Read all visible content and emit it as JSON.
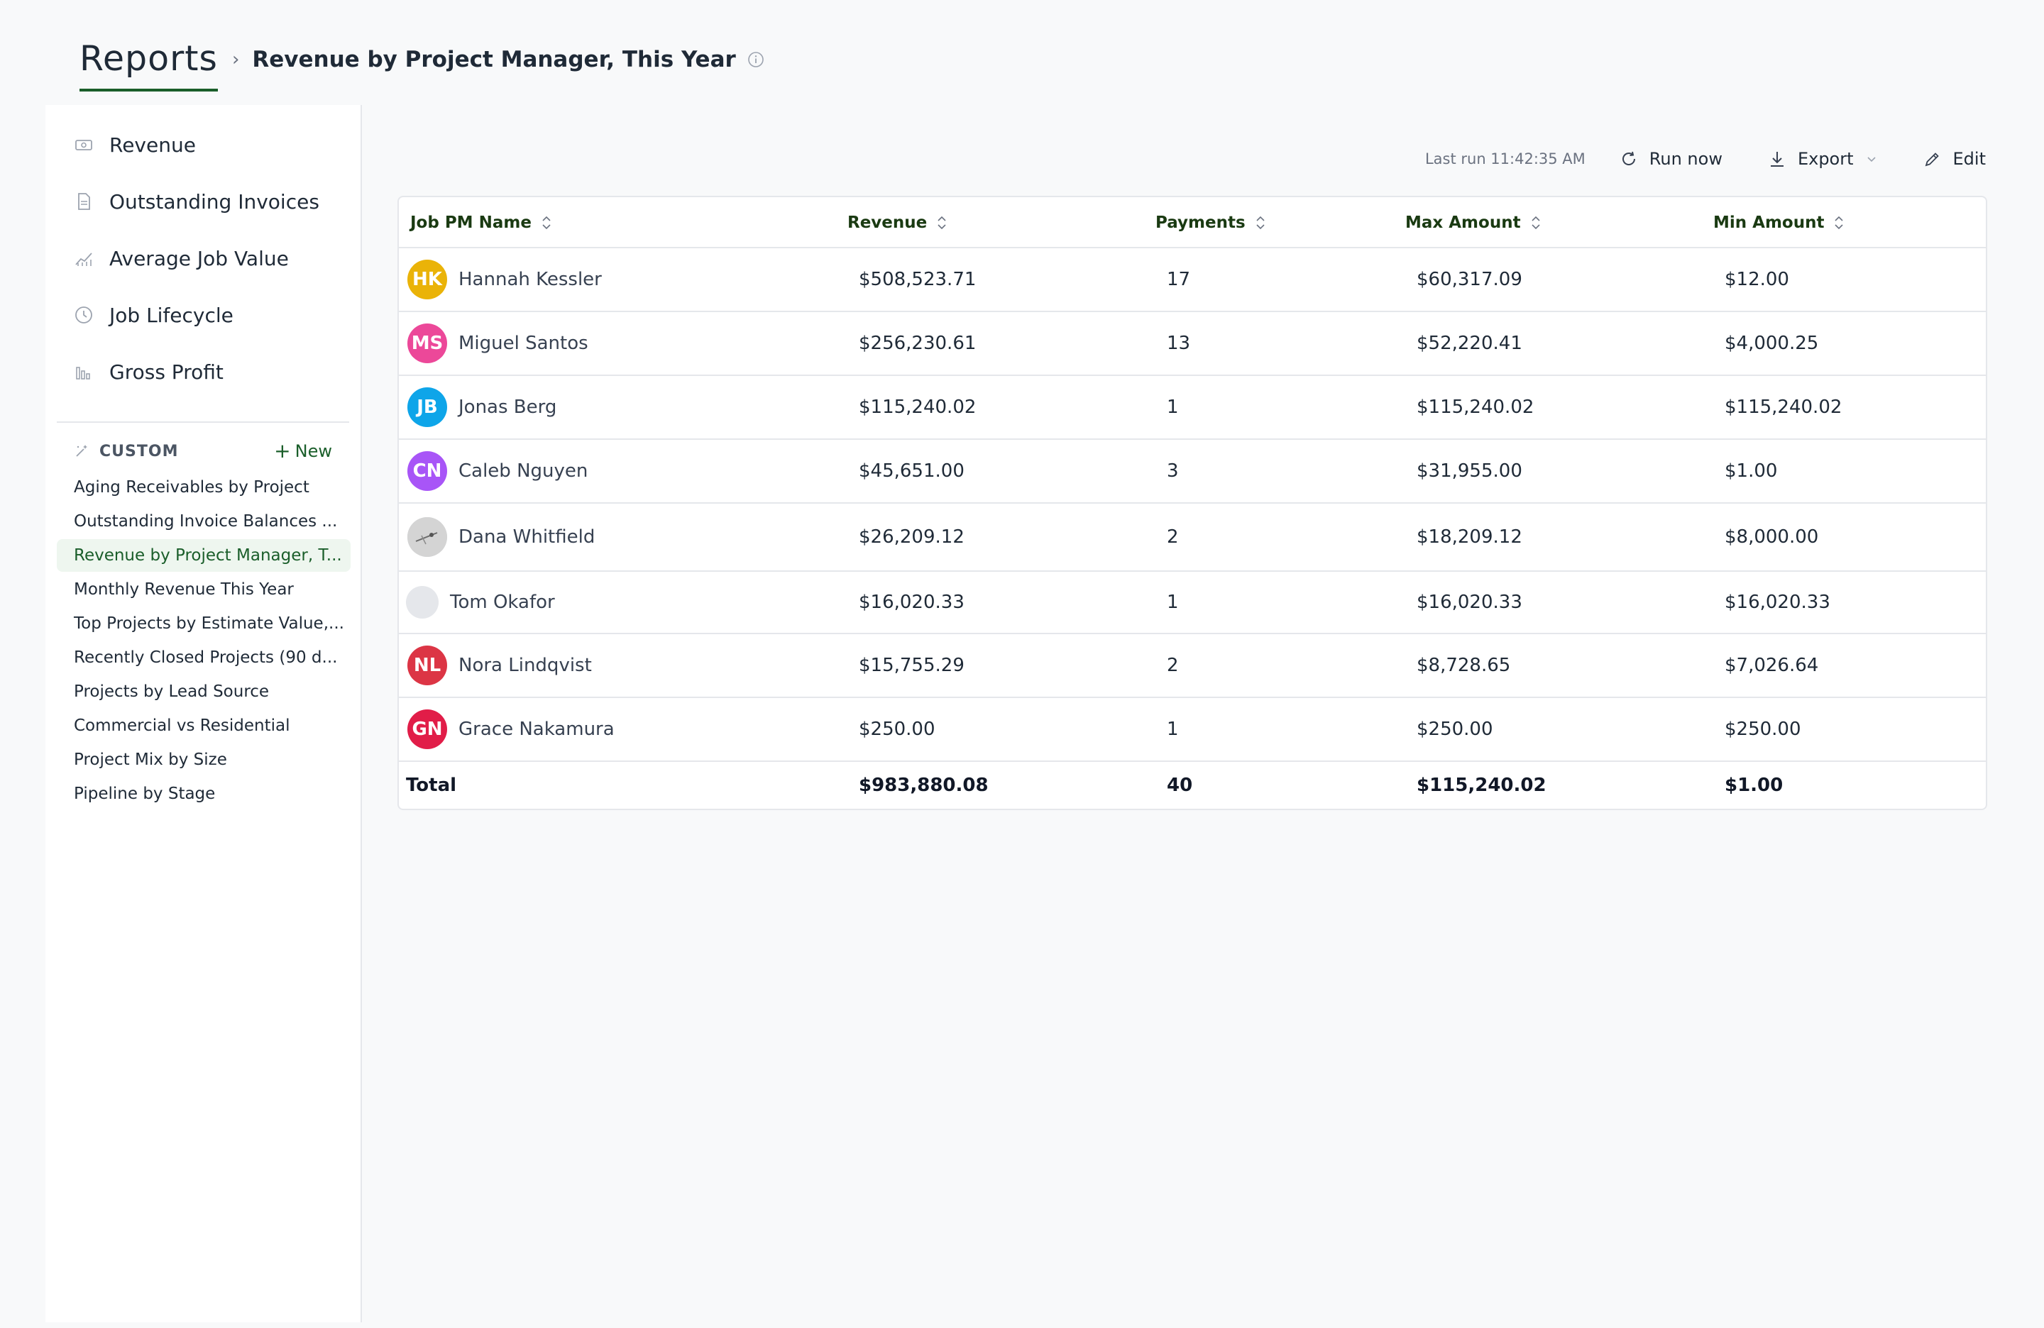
{
  "header": {
    "title": "Reports",
    "breadcrumb_separator": "›",
    "report_title": "Revenue by Project Manager, This Year"
  },
  "sidebar": {
    "items": [
      {
        "label": "Revenue",
        "icon": "money-icon"
      },
      {
        "label": "Outstanding Invoices",
        "icon": "document-icon"
      },
      {
        "label": "Average Job Value",
        "icon": "trend-chart-icon"
      },
      {
        "label": "Job Lifecycle",
        "icon": "clock-icon"
      },
      {
        "label": "Gross Profit",
        "icon": "bar-chart-icon"
      }
    ],
    "custom_label": "CUSTOM",
    "new_label": "New",
    "custom_items": [
      {
        "label": "Aging Receivables by Project"
      },
      {
        "label": "Outstanding Invoice Balances ..."
      },
      {
        "label": "Revenue by Project Manager, T..."
      },
      {
        "label": "Monthly Revenue This Year"
      },
      {
        "label": "Top Projects by Estimate Value,..."
      },
      {
        "label": "Recently Closed Projects (90 d..."
      },
      {
        "label": "Projects by Lead Source"
      },
      {
        "label": "Commercial vs Residential"
      },
      {
        "label": "Project Mix by Size"
      },
      {
        "label": "Pipeline by Stage"
      }
    ],
    "active_custom_index": 2
  },
  "toolbar": {
    "last_run": "Last run 11:42:35 AM",
    "run_now": "Run now",
    "export": "Export",
    "edit": "Edit"
  },
  "table": {
    "columns": [
      "Job PM Name",
      "Revenue",
      "Payments",
      "Max Amount",
      "Min Amount"
    ],
    "rows": [
      {
        "initials": "HK",
        "color": "#eab308",
        "name": "Hannah Kessler",
        "revenue": "$508,523.71",
        "payments": "17",
        "max": "$60,317.09",
        "min": "$12.00"
      },
      {
        "initials": "MS",
        "color": "#ec4899",
        "name": "Miguel Santos",
        "revenue": "$256,230.61",
        "payments": "13",
        "max": "$52,220.41",
        "min": "$4,000.25"
      },
      {
        "initials": "JB",
        "color": "#0ea5e9",
        "name": "Jonas Berg",
        "revenue": "$115,240.02",
        "payments": "1",
        "max": "$115,240.02",
        "min": "$115,240.02"
      },
      {
        "initials": "CN",
        "color": "#a855f7",
        "name": "Caleb Nguyen",
        "revenue": "$45,651.00",
        "payments": "3",
        "max": "$31,955.00",
        "min": "$1.00"
      },
      {
        "initials": "",
        "color": "photo",
        "name": "Dana Whitfield",
        "revenue": "$26,209.12",
        "payments": "2",
        "max": "$18,209.12",
        "min": "$8,000.00"
      },
      {
        "initials": "",
        "color": "empty",
        "name": "Tom Okafor",
        "revenue": "$16,020.33",
        "payments": "1",
        "max": "$16,020.33",
        "min": "$16,020.33"
      },
      {
        "initials": "NL",
        "color": "#dc3545",
        "name": "Nora Lindqvist",
        "revenue": "$15,755.29",
        "payments": "2",
        "max": "$8,728.65",
        "min": "$7,026.64"
      },
      {
        "initials": "GN",
        "color": "#e11d48",
        "name": "Grace Nakamura",
        "revenue": "$250.00",
        "payments": "1",
        "max": "$250.00",
        "min": "$250.00"
      }
    ],
    "total": {
      "label": "Total",
      "revenue": "$983,880.08",
      "payments": "40",
      "max": "$115,240.02",
      "min": "$1.00"
    }
  }
}
